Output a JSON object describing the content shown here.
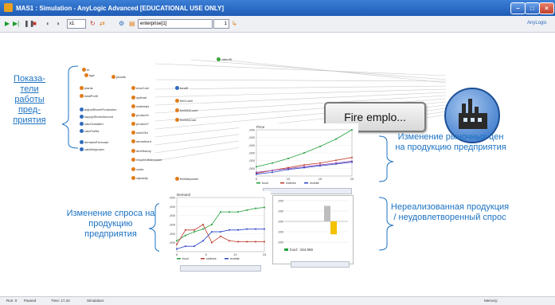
{
  "window": {
    "title": "MAS1 : Simulation - AnyLogic Advanced [EDUCATIONAL USE ONLY]",
    "controls": [
      "–",
      "□",
      "×"
    ]
  },
  "toolbar": {
    "speed_value": "x1",
    "object_selector": "enterprise[1]",
    "page_counter": "1",
    "brand": "AnyLogic"
  },
  "left_label": "Показа-\nтели\nработы\nпред-\nприятия",
  "annotations": {
    "price_change": "Изменение рыночных цен на продукцию предприятия",
    "demand_change": "Изменение спроса на продукцию предприятия",
    "unsold": "Нереализованная продукция / неудовлетворенный спрос"
  },
  "button_fire": "Fire emplo...",
  "model_elements": {
    "left_column": [
      "er",
      "age",
      "ploads",
      "plants",
      "totalProfit",
      "adjustStormProduction",
      "supplyStormAmount",
      "calcOutdated",
      "calcProfits",
      "demandForecast",
      "calcMarpower"
    ],
    "middle_column": [
      "emcCost",
      "optimal",
      "materials",
      "productX",
      "productY",
      "workOld",
      "aeroshiout",
      "devHistory",
      "requiredMarpower",
      "costs",
      "capacity"
    ],
    "right_column": [
      "fundE",
      "fireCostX",
      "fireMNCount",
      "fireMNCost",
      "fireMarpower"
    ],
    "top_item": "caleoSt"
  },
  "colors": {
    "food": "#1f9e3a",
    "clothes": "#c0392b",
    "mobile": "#2a44c9",
    "extra": "#8e44ad",
    "bar_grey": "#bdbdbd",
    "bar_yellow": "#f2c200"
  },
  "chart_data": [
    {
      "type": "line",
      "title": "Price",
      "x": [
        0,
        5,
        10,
        15,
        20,
        25,
        30
      ],
      "y_tick_labels": [
        ",000",
        ",000",
        ",000",
        ",000",
        ",000",
        ",000"
      ],
      "x_tick_labels": [
        "0",
        "10",
        "15",
        "20"
      ],
      "series": [
        {
          "name": "food",
          "values": [
            10,
            14,
            19,
            25,
            32,
            40,
            50
          ]
        },
        {
          "name": "clothes",
          "values": [
            3,
            6,
            9,
            12,
            14,
            17,
            20
          ]
        },
        {
          "name": "mobile",
          "values": [
            2,
            4,
            7,
            9,
            11,
            13,
            15
          ]
        },
        {
          "name": "",
          "values": [
            4,
            6,
            8,
            10,
            12,
            14,
            16
          ]
        }
      ],
      "ylim": [
        0,
        50
      ],
      "legend": "bottom"
    },
    {
      "type": "line",
      "title": "Demand",
      "x": [
        0,
        2,
        4,
        6,
        8,
        10,
        12,
        14,
        16,
        18,
        20
      ],
      "y_tick_labels": [
        ",000",
        ",000",
        ",000",
        ",000",
        ",000",
        ",000"
      ],
      "x_tick_labels": [
        "0",
        "5",
        "10",
        "15"
      ],
      "series": [
        {
          "name": "food",
          "values": [
            12,
            18,
            22,
            25,
            30,
            44,
            44,
            44,
            46,
            48,
            49
          ]
        },
        {
          "name": "clothes",
          "values": [
            8,
            24,
            24,
            30,
            10,
            17,
            12,
            11,
            11,
            11,
            11
          ]
        },
        {
          "name": "mobile",
          "values": [
            3,
            6,
            6,
            12,
            22,
            22,
            24,
            24,
            25,
            25,
            25
          ]
        }
      ],
      "ylim": [
        0,
        60
      ],
      "legend": "bottom"
    },
    {
      "type": "bar",
      "title": "",
      "categories": [
        "food",
        "clothes"
      ],
      "values": [
        -30,
        25
      ],
      "legend": "food: -154,956",
      "y_tick_labels": [
        ",000",
        ",000",
        ",000",
        ",000",
        ",000"
      ]
    }
  ],
  "status": {
    "run": "Run: 0",
    "state": "Paused",
    "time": "Time: 17,43",
    "simulation": "Simulation:",
    "memory": "Memory:"
  }
}
